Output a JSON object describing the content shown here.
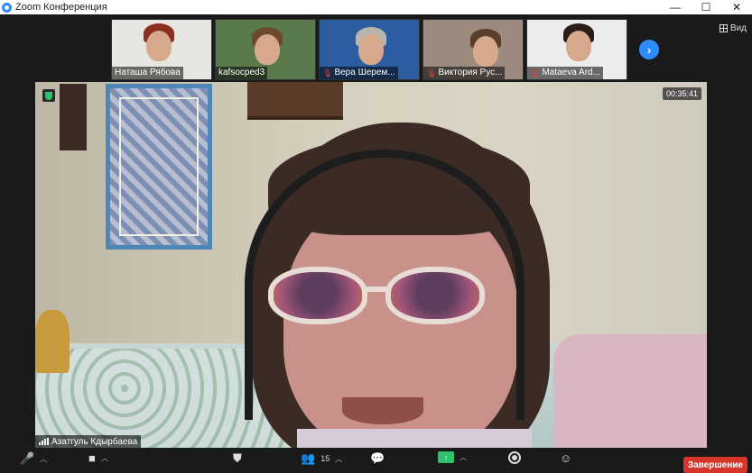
{
  "window": {
    "title": "Zoom Конференция",
    "minimize": "—",
    "maximize": "☐",
    "close": "✕"
  },
  "view": {
    "label": "Вид"
  },
  "thumbnails": [
    {
      "name": "Наташа Рябова",
      "muted": false,
      "bg": "#e8e6e1",
      "hair": "#8b2f1e"
    },
    {
      "name": "kafsocped3",
      "muted": false,
      "bg": "#5b7a4c",
      "hair": "#6b4a2e"
    },
    {
      "name": "Вера Шерем...",
      "muted": true,
      "bg": "#2b5da0",
      "hair": "#b9b5ad"
    },
    {
      "name": "Виктория Рус...",
      "muted": true,
      "bg": "#9c8a7e",
      "hair": "#5a3d2a"
    },
    {
      "name": "Mataeva Ard...",
      "muted": true,
      "bg": "#ececec",
      "hair": "#2a1d18"
    }
  ],
  "main": {
    "timer": "00:35:41",
    "speaker_name": "Азатгуль Кдырбаева"
  },
  "toolbar": {
    "participants_count": "15",
    "end_label": "Завершение"
  },
  "colors": {
    "accent": "#2d8cff",
    "end": "#d9362b",
    "share": "#2ec36b"
  }
}
